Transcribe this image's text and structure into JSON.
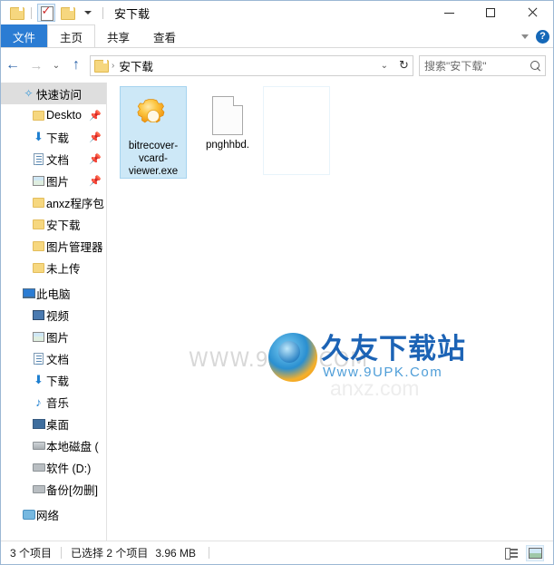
{
  "window": {
    "title": "安下载",
    "quick_access_toolbar": [
      {
        "name": "folder-icon",
        "label": "属性"
      },
      {
        "name": "properties-checkmark-icon",
        "label": "属性"
      },
      {
        "name": "folder-icon",
        "label": "新建文件夹"
      },
      {
        "name": "chevron-down-icon",
        "label": "自定义快速访问工具栏"
      }
    ],
    "controls": {
      "minimize": "—",
      "maximize": "□",
      "close": "✕"
    }
  },
  "ribbon": {
    "tabs": [
      {
        "label": "文件",
        "state": "file"
      },
      {
        "label": "主页",
        "state": "active"
      },
      {
        "label": "共享",
        "state": "normal"
      },
      {
        "label": "查看",
        "state": "normal"
      }
    ],
    "collapse_label": "展开功能区",
    "help_label": "?"
  },
  "address": {
    "back": "←",
    "forward": "→",
    "history": "⌄",
    "up": "↑",
    "crumb_separator": "›",
    "crumb": "安下载",
    "dropdown": "⌄",
    "refresh": "↻"
  },
  "search": {
    "placeholder": "搜索\"安下载\"",
    "icon": "search-icon"
  },
  "sidebar": {
    "items": [
      {
        "label": "快速访问",
        "icon": "star-icon",
        "indent": 0,
        "selected": true,
        "pinned": false
      },
      {
        "label": "Deskto",
        "icon": "folder-icon",
        "indent": 1,
        "selected": false,
        "pinned": true
      },
      {
        "label": "下载",
        "icon": "download-icon",
        "indent": 1,
        "selected": false,
        "pinned": true
      },
      {
        "label": "文档",
        "icon": "document-icon",
        "indent": 1,
        "selected": false,
        "pinned": true
      },
      {
        "label": "图片",
        "icon": "picture-icon",
        "indent": 1,
        "selected": false,
        "pinned": true
      },
      {
        "label": "anxz程序包",
        "icon": "folder-icon",
        "indent": 1,
        "selected": false,
        "pinned": false
      },
      {
        "label": "安下载",
        "icon": "folder-icon",
        "indent": 1,
        "selected": false,
        "pinned": false
      },
      {
        "label": "图片管理器",
        "icon": "folder-icon",
        "indent": 1,
        "selected": false,
        "pinned": false
      },
      {
        "label": "未上传",
        "icon": "folder-icon",
        "indent": 1,
        "selected": false,
        "pinned": false
      },
      {
        "label": "此电脑",
        "icon": "this-pc-icon",
        "indent": 0,
        "selected": false,
        "pinned": false
      },
      {
        "label": "视频",
        "icon": "video-icon",
        "indent": 1,
        "selected": false,
        "pinned": false
      },
      {
        "label": "图片",
        "icon": "picture-icon",
        "indent": 1,
        "selected": false,
        "pinned": false
      },
      {
        "label": "文档",
        "icon": "document-icon",
        "indent": 1,
        "selected": false,
        "pinned": false
      },
      {
        "label": "下载",
        "icon": "download-icon",
        "indent": 1,
        "selected": false,
        "pinned": false
      },
      {
        "label": "音乐",
        "icon": "music-icon",
        "indent": 1,
        "selected": false,
        "pinned": false
      },
      {
        "label": "桌面",
        "icon": "desktop-icon",
        "indent": 1,
        "selected": false,
        "pinned": false
      },
      {
        "label": "本地磁盘 (",
        "icon": "local-drive-icon",
        "indent": 1,
        "selected": false,
        "pinned": false
      },
      {
        "label": "软件 (D:)",
        "icon": "drive-icon",
        "indent": 1,
        "selected": false,
        "pinned": false
      },
      {
        "label": "备份[勿删]",
        "icon": "drive-icon",
        "indent": 1,
        "selected": false,
        "pinned": false
      },
      {
        "label": "网络",
        "icon": "network-icon",
        "indent": 0,
        "selected": false,
        "pinned": false
      }
    ]
  },
  "files": {
    "items": [
      {
        "name": "bitrecover-vcard-viewer.exe",
        "icon": "gear-exe-icon",
        "selected": true
      },
      {
        "name": "pnghhbd.",
        "icon": "blank-file-icon",
        "selected": false
      },
      {
        "name": "",
        "icon": "ghost-item",
        "selected": false
      }
    ]
  },
  "watermark": {
    "faint_left": "WWW.9UPK.COM",
    "faint_center": "anxz.com",
    "brand_cn": "久友下载站",
    "brand_en": "Www.9UPK.Com"
  },
  "status": {
    "item_count": "3 个项目",
    "selection": "已选择 2 个项目",
    "size": "3.96 MB",
    "views": [
      {
        "name": "details-view-button",
        "selected": false
      },
      {
        "name": "large-icons-view-button",
        "selected": true
      }
    ]
  },
  "colors": {
    "accent": "#2b7cd3",
    "selection": "#cde8f7",
    "folder": "#f6d77f",
    "brand_blue": "#1c63b5"
  }
}
